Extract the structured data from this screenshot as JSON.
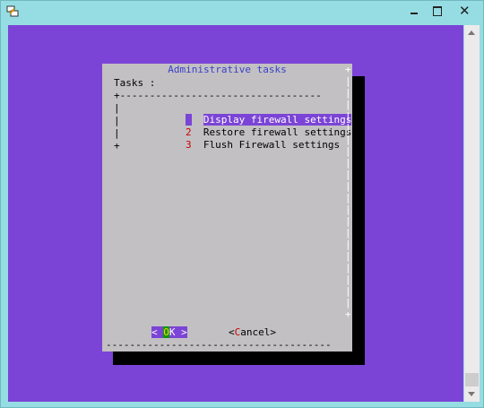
{
  "window": {
    "close_glyph": "✕"
  },
  "dialog": {
    "title": "Administrative tasks",
    "tasks_label": "Tasks :",
    "rule_top": "+----------------------------------",
    "pipe": "|",
    "plus": "+",
    "items": [
      {
        "num": "1",
        "label": "Display firewall settings",
        "selected": true
      },
      {
        "num": "2",
        "label": "Restore firewall settings",
        "selected": false
      },
      {
        "num": "3",
        "label": "Flush Firewall settings",
        "selected": false
      }
    ],
    "right_edge": "+\n|\n|\n|\n|\n|\n|\n|\n|\n|\n|\n|\n|\n|\n|\n|\n|\n|\n|\n|\n|\n+",
    "bottom_rule": "--------------------------------------",
    "ok": {
      "left": "< ",
      "hot": "O",
      "rest": "K",
      "right": " >"
    },
    "cancel": {
      "left": "<",
      "hot": "C",
      "rest": "ancel>"
    }
  },
  "colors": {
    "terminal_bg": "#7b44d6",
    "dialog_bg": "#c2c0c2",
    "title_color": "#3a40c8",
    "hotkey_red": "#cc0000",
    "ok_hot_bg": "#0a9a00",
    "ok_hot_fg": "#ffd700"
  },
  "icons": {
    "app": "putty-icon",
    "minimize": "minimize-icon",
    "maximize": "maximize-icon",
    "close": "close-icon"
  }
}
